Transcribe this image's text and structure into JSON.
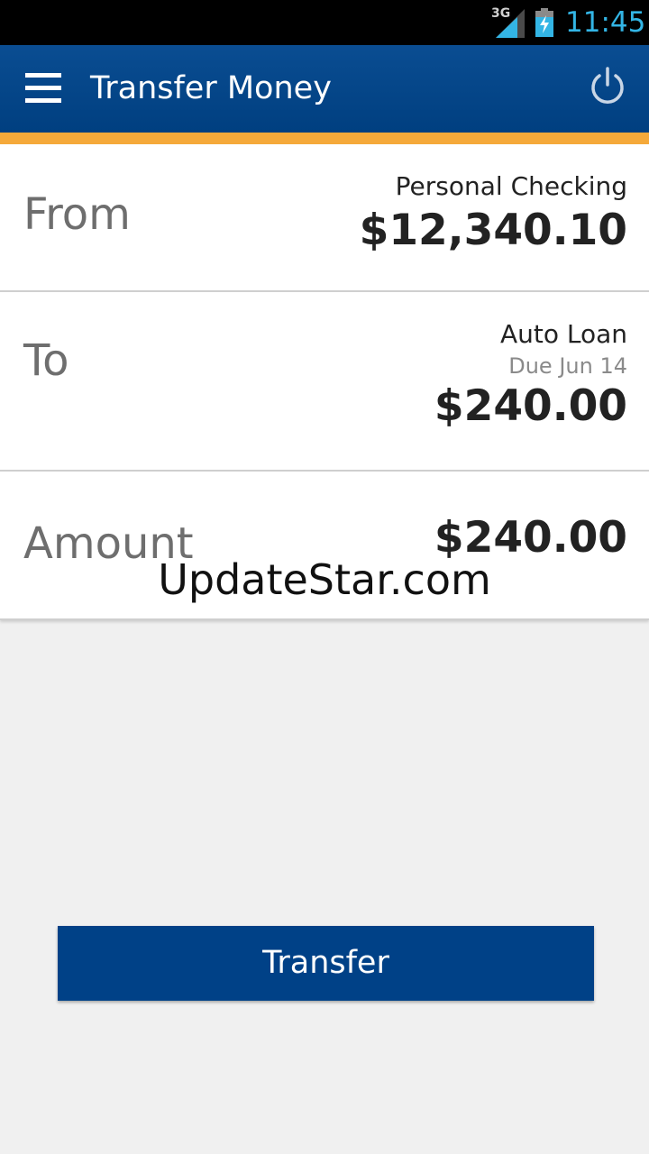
{
  "status_bar": {
    "network_type": "3G",
    "time": "11:45",
    "icons": [
      "signal-icon",
      "battery-charging-icon"
    ]
  },
  "app_bar": {
    "title": "Transfer Money",
    "icons": [
      "menu-icon",
      "power-icon"
    ],
    "colors": {
      "bar": "#0a4d92",
      "accent": "#f5a93a"
    }
  },
  "from": {
    "label": "From",
    "account_name": "Personal Checking",
    "balance": "$12,340.10"
  },
  "to": {
    "label": "To",
    "account_name": "Auto Loan",
    "due": "Due Jun 14",
    "amount": "$240.00"
  },
  "amount": {
    "label": "Amount",
    "value": "$240.00"
  },
  "watermark": "UpdateStar.com",
  "transfer_button": {
    "label": "Transfer",
    "color": "#004187"
  }
}
